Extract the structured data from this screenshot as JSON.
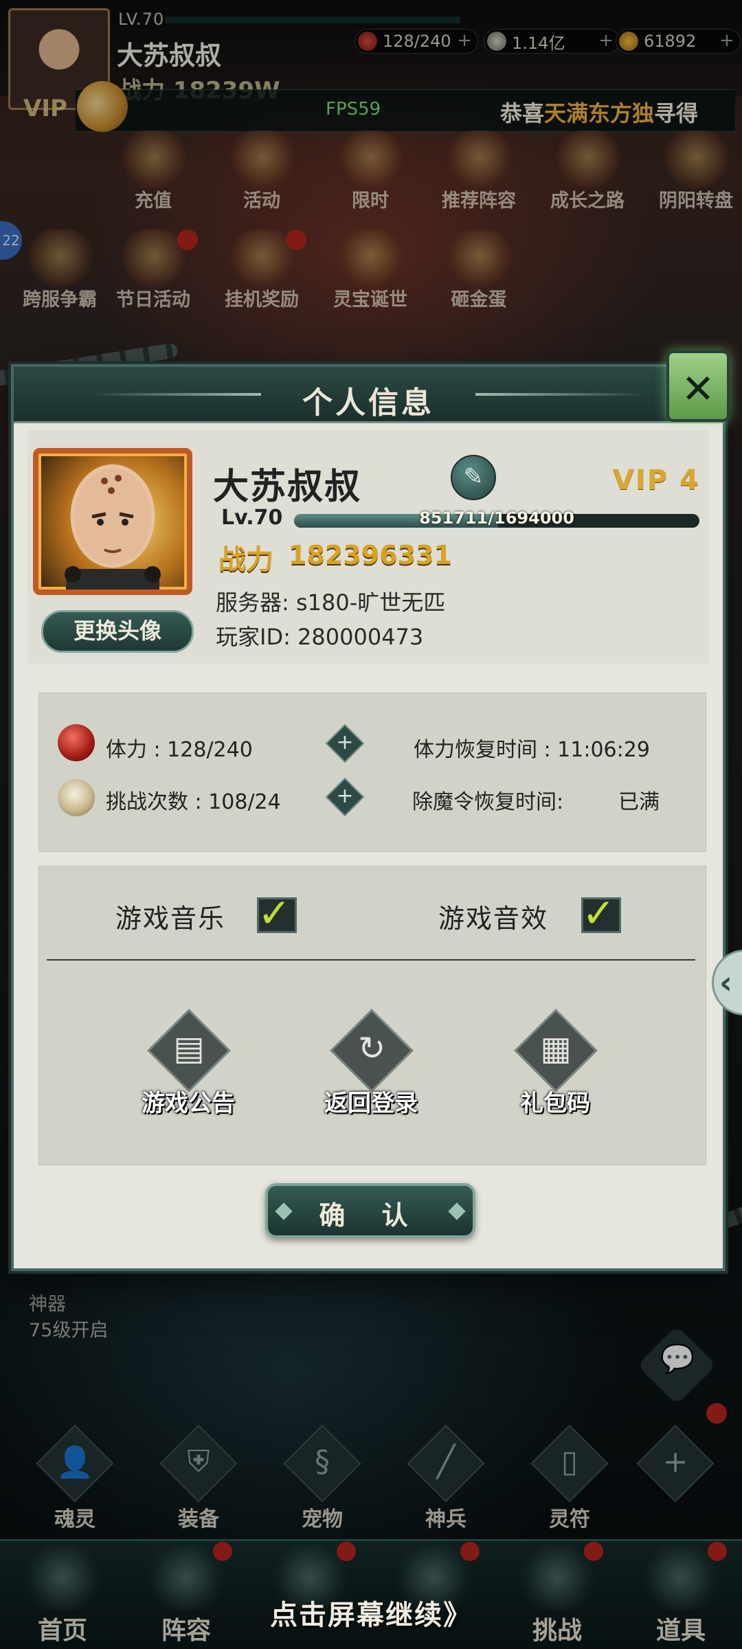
{
  "top": {
    "level": "LV.70",
    "name": "大苏叔叔",
    "power": "战力 18239W",
    "vip": "VIP",
    "stamina": "128/240",
    "coins": "1.14亿",
    "ingots": "61892",
    "fps": "FPS59",
    "marquee_prefix": "恭喜",
    "marquee_highlight": "天满东方独",
    "marquee_suffix": "寻得"
  },
  "activities_row1": [
    "充值",
    "活动",
    "限时",
    "推荐阵容",
    "成长之路",
    "阴阳转盘"
  ],
  "activities_row2": [
    "跨服争霸",
    "节日活动",
    "挂机奖励",
    "灵宝诞世",
    "砸金蛋"
  ],
  "edge_badge": "22",
  "dialog": {
    "title": "个人信息",
    "close_label": "✕",
    "change_avatar": "更换头像",
    "name": "大苏叔叔",
    "vip": "VIP 4",
    "level": "Lv.70",
    "xp_text": "851711/1694000",
    "xp_fraction": 0.503,
    "power_label": "战力",
    "power_value": "182396331",
    "server": "服务器: s180-旷世无匹",
    "player_id": "玩家ID: 280000473",
    "stamina_label": "体力 : 128/240",
    "challenge_label": "挑战次数 : 108/24",
    "stamina_recover": "体力恢复时间 : 11:06:29",
    "demon_recover_label": "除魔令恢复时间:",
    "demon_recover_value": "已满",
    "music_label": "游戏音乐",
    "sfx_label": "游戏音效",
    "announce": "游戏公告",
    "back_login": "返回登录",
    "gift_code": "礼包码",
    "confirm": "确 认"
  },
  "hud": {
    "shenqi_line1": "神器",
    "shenqi_line2": "75级开启",
    "slots": [
      "魂灵",
      "装备",
      "宠物",
      "神兵",
      "灵符"
    ]
  },
  "nav": [
    "首页",
    "阵容",
    "",
    "",
    "挑战",
    "道具"
  ],
  "continue_text": "点击屏幕继续》",
  "colors": {
    "accent_teal": "#2b4944",
    "gold": "#d8a224",
    "check": "#c5de3c",
    "badge_red": "#b8241c"
  }
}
